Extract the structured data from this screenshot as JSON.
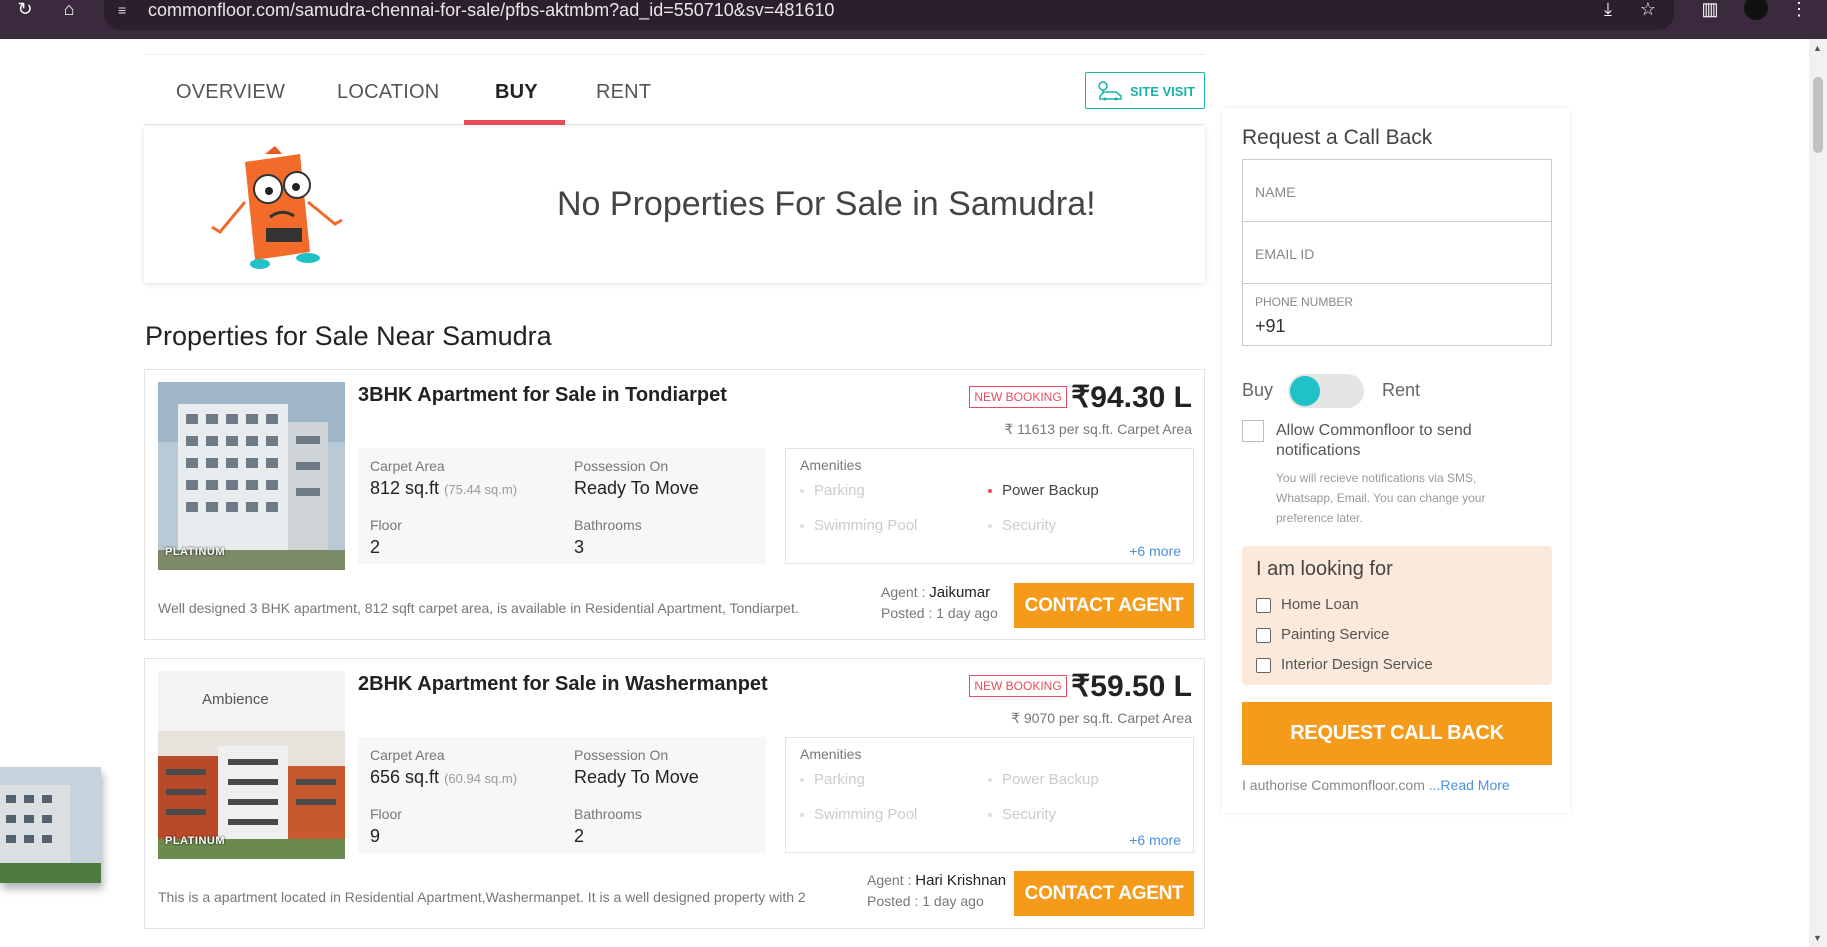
{
  "browser": {
    "url": "commonfloor.com/samudra-chennai-for-sale/pfbs-aktmbm?ad_id=550710&sv=481610"
  },
  "tabs": [
    {
      "label": "OVERVIEW"
    },
    {
      "label": "LOCATION"
    },
    {
      "label": "BUY"
    },
    {
      "label": "RENT"
    }
  ],
  "site_visit_label": "SITE VISIT",
  "no_properties_message": "No Properties For Sale in Samudra!",
  "section_title": "Properties for Sale Near Samudra",
  "listings": [
    {
      "badge": "PLATINUM",
      "title": "3BHK Apartment for Sale in Tondiarpet",
      "booking": "NEW BOOKING",
      "price": "₹94.30 L",
      "per_sqft": "₹ 11613 per sq.ft. Carpet Area",
      "carpet_label": "Carpet Area",
      "carpet_value": "812 sq.ft",
      "carpet_sub": "(75.44 sq.m)",
      "possession_label": "Possession On",
      "possession_value": "Ready To Move",
      "floor_label": "Floor",
      "floor_value": "2",
      "bath_label": "Bathrooms",
      "bath_value": "3",
      "amenities_title": "Amenities",
      "amenities": [
        "Parking",
        "Power Backup",
        "Swimming Pool",
        "Security"
      ],
      "more": "+6 more",
      "description": "Well designed 3 BHK apartment, 812 sqft carpet area, is available in Residential Apartment, Tondiarpet.",
      "agent_label": "Agent :",
      "agent_name": "Jaikumar",
      "posted": "Posted : 1 day ago",
      "contact": "CONTACT AGENT"
    },
    {
      "badge": "PLATINUM",
      "thumb_text": "Ambience",
      "title": "2BHK Apartment for Sale in Washermanpet",
      "booking": "NEW BOOKING",
      "price": "₹59.50 L",
      "per_sqft": "₹ 9070 per sq.ft. Carpet Area",
      "carpet_label": "Carpet Area",
      "carpet_value": "656 sq.ft",
      "carpet_sub": "(60.94 sq.m)",
      "possession_label": "Possession On",
      "possession_value": "Ready To Move",
      "floor_label": "Floor",
      "floor_value": "9",
      "bath_label": "Bathrooms",
      "bath_value": "2",
      "amenities_title": "Amenities",
      "amenities": [
        "Parking",
        "Power Backup",
        "Swimming Pool",
        "Security"
      ],
      "more": "+6 more",
      "description": "This is a apartment located in Residential Apartment,Washermanpet. It is a well designed property with 2",
      "agent_label": "Agent :",
      "agent_name": "Hari Krishnan",
      "posted": "Posted : 1 day ago",
      "contact": "CONTACT AGENT"
    }
  ],
  "sidebar": {
    "heading": "Request a Call Back",
    "name_placeholder": "NAME",
    "email_placeholder": "EMAIL ID",
    "phone_label": "PHONE NUMBER",
    "phone_prefix": "+91",
    "toggle_buy": "Buy",
    "toggle_rent": "Rent",
    "notify_label": "Allow Commonfloor to send notifications",
    "notify_sub": "You will recieve notifications via SMS, Whatsapp, Email. You can change your preference later.",
    "looking_heading": "I am looking for",
    "looking_options": [
      "Home Loan",
      "Painting Service",
      "Interior Design Service"
    ],
    "request_button": "REQUEST CALL BACK",
    "auth_text": "I authorise Commonfloor.com",
    "read_more": " ...Read More"
  },
  "colors": {
    "accent_orange": "#f59b1c",
    "accent_red": "#e84c5a",
    "accent_teal": "#17b3a8",
    "toggle_knob": "#1fc2c6"
  }
}
